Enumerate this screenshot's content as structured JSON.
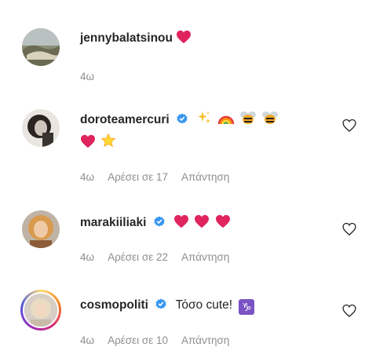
{
  "comments": [
    {
      "username": "jennybalatsinou",
      "verified": false,
      "text": "",
      "time": "4ω",
      "likes": "",
      "reply": ""
    },
    {
      "username": "doroteamercuri",
      "verified": true,
      "text": "",
      "time": "4ω",
      "likes": "Αρέσει σε 17",
      "reply": "Απάντηση"
    },
    {
      "username": "marakiiliaki",
      "verified": true,
      "text": "",
      "time": "4ω",
      "likes": "Αρέσει σε 22",
      "reply": "Απάντηση"
    },
    {
      "username": "cosmopoliti",
      "verified": true,
      "text": "Τόσο cute!",
      "time": "4ω",
      "likes": "Αρέσει σε 10",
      "reply": "Απάντηση"
    }
  ],
  "colors": {
    "verified": "#3897f0",
    "heart": "#e0245e",
    "muted": "#8e8e8e"
  }
}
